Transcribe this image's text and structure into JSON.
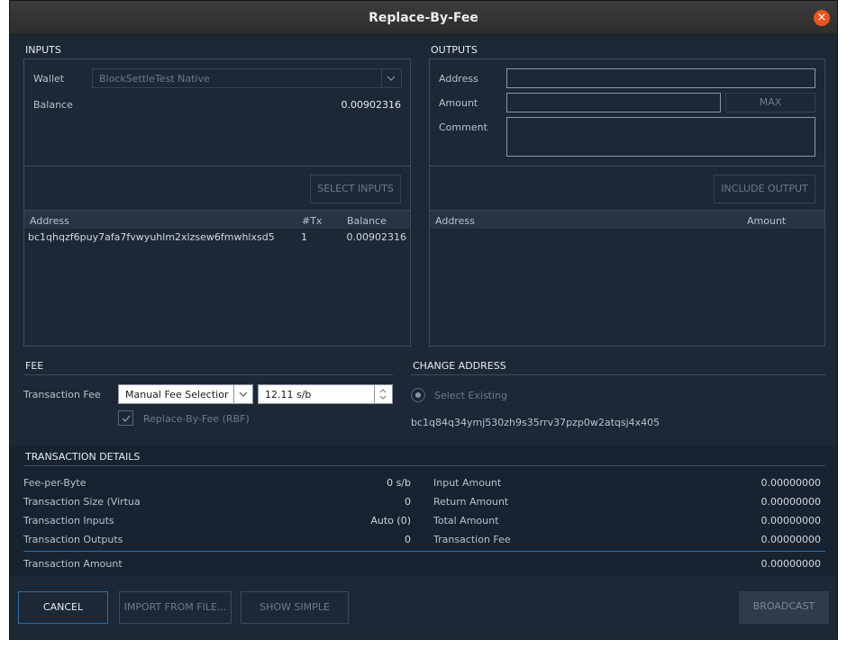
{
  "window": {
    "title": "Replace-By-Fee",
    "close_symbol": "×"
  },
  "inputs": {
    "section_title": "INPUTS",
    "wallet_label": "Wallet",
    "wallet_value": "BlockSettleTest Native",
    "balance_label": "Balance",
    "balance_value": "0.00902316",
    "select_inputs_label": "SELECT INPUTS",
    "table": {
      "columns": [
        "Address",
        "#Tx",
        "Balance"
      ],
      "rows": [
        {
          "address": "bc1qhqzf6puy7afa7fvwyuhlm2xlzsew6fmwhlxsd5",
          "tx": "1",
          "balance": "0.00902316"
        }
      ]
    }
  },
  "outputs": {
    "section_title": "OUTPUTS",
    "address_label": "Address",
    "amount_label": "Amount",
    "max_label": "MAX",
    "comment_label": "Comment",
    "include_output_label": "INCLUDE OUTPUT",
    "table": {
      "columns": [
        "Address",
        "Amount"
      ]
    }
  },
  "fee": {
    "section_title": "FEE",
    "transaction_fee_label": "Transaction Fee",
    "fee_selection_value": "Manual Fee Selectior",
    "fee_rate_value": "12.11 s/b",
    "rbf_label": "Replace-By-Fee (RBF)",
    "rbf_checked": true
  },
  "change_address": {
    "section_title": "CHANGE ADDRESS",
    "select_existing_label": "Select Existing",
    "address": "bc1q84q34ymj530zh9s35rrv37pzp0w2atqsj4x405"
  },
  "details": {
    "section_title": "TRANSACTION DETAILS",
    "left": [
      {
        "label": "Fee-per-Byte",
        "value": "0 s/b"
      },
      {
        "label": "Transaction Size (Virtua",
        "value": "0"
      },
      {
        "label": "Transaction Inputs",
        "value": "Auto (0)"
      },
      {
        "label": "Transaction Outputs",
        "value": "0"
      }
    ],
    "right": [
      {
        "label": "Input Amount",
        "value": "0.00000000"
      },
      {
        "label": "Return Amount",
        "value": "0.00000000"
      },
      {
        "label": "Total Amount",
        "value": "0.00000000"
      },
      {
        "label": "Transaction Fee",
        "value": "0.00000000"
      }
    ],
    "total_label": "Transaction Amount",
    "total_value": "0.00000000"
  },
  "buttons": {
    "cancel": "CANCEL",
    "import": "IMPORT FROM FILE...",
    "show_simple": "SHOW SIMPLE",
    "broadcast": "BROADCAST"
  },
  "colors": {
    "accent": "#2b6fa8",
    "close": "#e9541f",
    "background": "#1c2835"
  }
}
